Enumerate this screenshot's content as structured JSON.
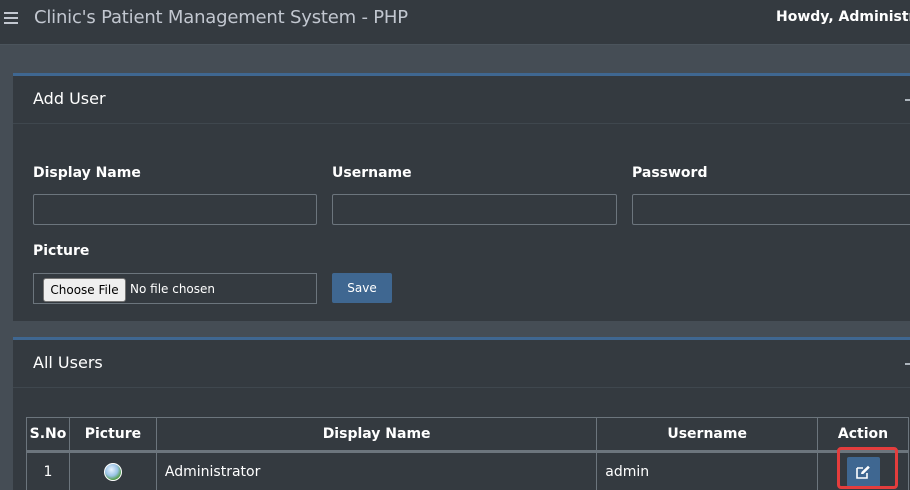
{
  "navbar": {
    "menu_icon": "hamburger-icon",
    "title": "Clinic's Patient Management System - PHP",
    "greeting": "Howdy, Administra"
  },
  "add_user": {
    "title": "Add User",
    "collapse_icon": "minus-icon",
    "display_name_label": "Display Name",
    "display_name_value": "",
    "username_label": "Username",
    "username_value": "",
    "password_label": "Password",
    "password_value": "",
    "picture_label": "Picture",
    "choose_file_label": "Choose File",
    "file_status": "No file chosen",
    "save_label": "Save"
  },
  "all_users": {
    "title": "All Users",
    "collapse_icon": "minus-icon",
    "columns": [
      "S.No",
      "Picture",
      "Display Name",
      "Username",
      "Action"
    ],
    "rows": [
      {
        "sno": "1",
        "picture_icon": "avatar-image",
        "display_name": "Administrator",
        "username": "admin",
        "action_icon": "edit-icon"
      }
    ]
  },
  "colors": {
    "navbar_bg": "#343a40",
    "page_bg": "#454d55",
    "card_accent": "#3f6791",
    "primary_button": "#3f6791",
    "highlight": "#e43d3d"
  }
}
